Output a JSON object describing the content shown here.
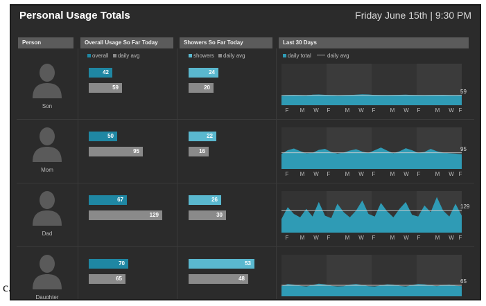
{
  "dashboard": {
    "title": "Personal Usage Totals",
    "datetime": "Friday June 15th | 9:30 PM"
  },
  "columns": {
    "person": "Person",
    "overall": "Overall Usage So Far Today",
    "showers": "Showers So Far Today",
    "last30": "Last 30 Days"
  },
  "legends": {
    "overall": [
      "overall",
      "daily avg"
    ],
    "showers": [
      "showers",
      "daily avg"
    ],
    "last30": [
      "daily total",
      "daily avg"
    ]
  },
  "colors": {
    "overall": "#1f87a3",
    "showers": "#5ab8cf",
    "avg": "#8a8a8a",
    "area": "#2f9bb5"
  },
  "day_labels": [
    "F",
    "M",
    "W",
    "F",
    "M",
    "W",
    "F",
    "M",
    "W",
    "F",
    "M",
    "W",
    "F"
  ],
  "people": [
    {
      "name": "Son",
      "overall": 42,
      "overall_avg": 59,
      "showers": 24,
      "showers_avg": 20,
      "avg30": 59,
      "series": [
        55,
        58,
        60,
        57,
        56,
        62,
        63,
        61,
        58,
        56,
        57,
        60,
        62,
        64,
        63,
        60,
        58,
        57,
        59,
        61,
        62,
        60,
        58,
        57,
        59,
        60,
        61,
        58,
        57,
        59
      ]
    },
    {
      "name": "Mom",
      "overall": 50,
      "overall_avg": 95,
      "showers": 22,
      "showers_avg": 16,
      "avg30": 95,
      "series": [
        88,
        110,
        120,
        105,
        92,
        95,
        112,
        118,
        100,
        90,
        96,
        108,
        116,
        102,
        94,
        110,
        126,
        108,
        92,
        104,
        122,
        110,
        95,
        100,
        118,
        104,
        96,
        92,
        90,
        86
      ]
    },
    {
      "name": "Dad",
      "overall": 67,
      "overall_avg": 129,
      "showers": 26,
      "showers_avg": 30,
      "avg30": 129,
      "series": [
        80,
        150,
        110,
        90,
        140,
        95,
        180,
        100,
        85,
        170,
        120,
        90,
        130,
        190,
        110,
        95,
        175,
        125,
        90,
        140,
        180,
        105,
        95,
        160,
        120,
        210,
        130,
        95,
        170,
        100
      ]
    },
    {
      "name": "Daughter",
      "overall": 70,
      "overall_avg": 65,
      "showers": 53,
      "showers_avg": 48,
      "avg30": 65,
      "series": [
        60,
        72,
        68,
        62,
        58,
        66,
        74,
        70,
        62,
        58,
        60,
        68,
        72,
        66,
        60,
        58,
        64,
        70,
        68,
        62,
        58,
        66,
        72,
        70,
        64,
        60,
        66,
        68,
        62,
        60
      ]
    }
  ],
  "caption": "c."
}
